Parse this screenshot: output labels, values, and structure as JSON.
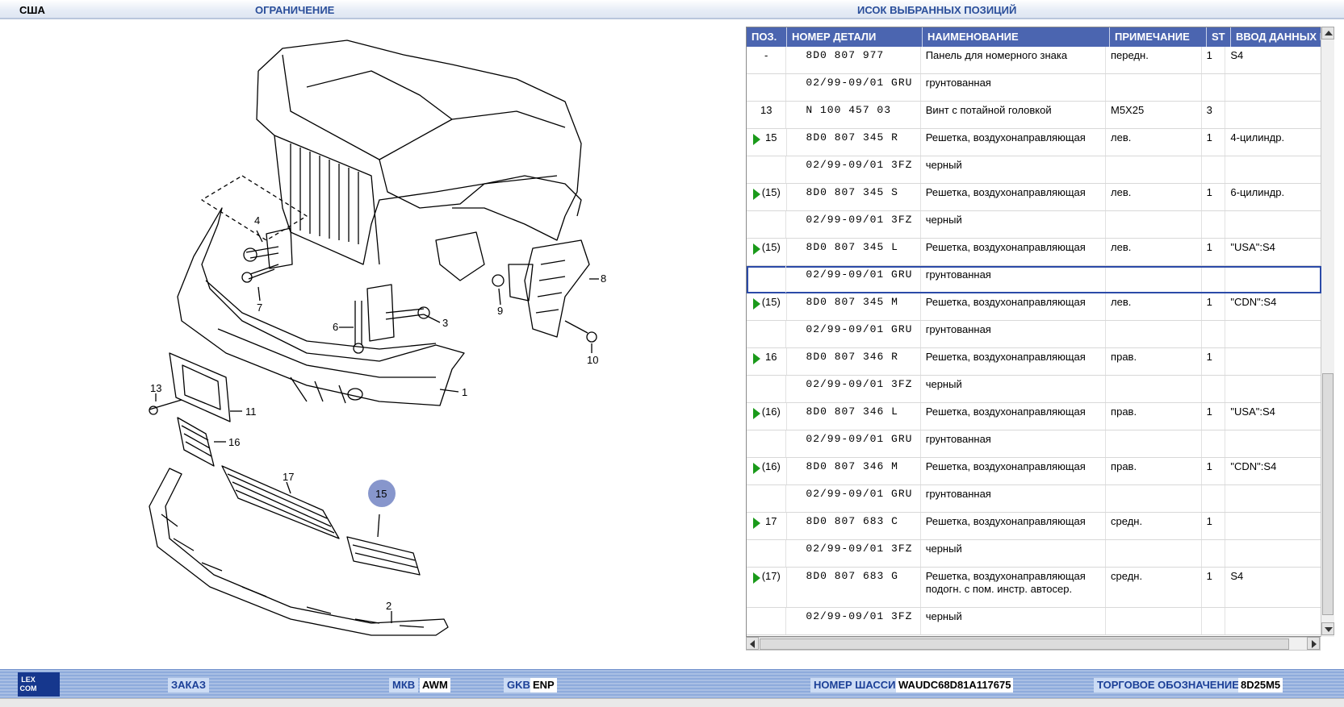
{
  "header": {
    "country": "США",
    "restriction_label": "ОГРАНИЧЕНИЕ",
    "selected_list_label": "ИСОК ВЫБРАННЫХ ПОЗИЦИЙ"
  },
  "diagram": {
    "callouts": [
      "4",
      "7",
      "6",
      "3",
      "8",
      "9",
      "10",
      "1",
      "13",
      "11",
      "16",
      "17",
      "15",
      "2"
    ],
    "highlighted_callout": "15",
    "highlight_color": "#8796cc"
  },
  "table": {
    "columns": [
      "ПОЗ.",
      "НОМЕР ДЕТАЛИ",
      "НАИМЕНОВАНИЕ",
      "ПРИМЕЧАНИЕ",
      "ST",
      "ВВОД ДАННЫХ ПО"
    ],
    "header_color": "#4b65b0",
    "rows": [
      {
        "pos": "-",
        "part": "8D0 807 977",
        "name": "Панель для номерного знака",
        "note": "передн.",
        "st": "1",
        "data": "S4",
        "arrow": false
      },
      {
        "pos": "",
        "part": "02/99-09/01 GRU",
        "name": "грунтованная",
        "note": "",
        "st": "",
        "data": "",
        "arrow": false
      },
      {
        "pos": "13",
        "part": "N   100 457 03",
        "name": "Винт с потайной головкой",
        "note": "M5X25",
        "st": "3",
        "data": "",
        "arrow": false
      },
      {
        "pos": "15",
        "part": "8D0 807 345 R",
        "name": "Решетка, воздухонаправляющая",
        "note": "лев.",
        "st": "1",
        "data": "4-цилиндр.",
        "arrow": true
      },
      {
        "pos": "",
        "part": "02/99-09/01 3FZ",
        "name": "черный",
        "note": "",
        "st": "",
        "data": "",
        "arrow": false
      },
      {
        "pos": "(15)",
        "part": "8D0 807 345 S",
        "name": "Решетка, воздухонаправляющая",
        "note": "лев.",
        "st": "1",
        "data": "6-цилиндр.",
        "arrow": true
      },
      {
        "pos": "",
        "part": "02/99-09/01 3FZ",
        "name": "черный",
        "note": "",
        "st": "",
        "data": "",
        "arrow": false
      },
      {
        "pos": "(15)",
        "part": "8D0 807 345 L",
        "name": "Решетка, воздухонаправляющая",
        "note": "лев.",
        "st": "1",
        "data": "\"USA\":S4",
        "arrow": true
      },
      {
        "pos": "",
        "part": "02/99-09/01 GRU",
        "name": "грунтованная",
        "note": "",
        "st": "",
        "data": "",
        "arrow": false,
        "selected": true
      },
      {
        "pos": "(15)",
        "part": "8D0 807 345 M",
        "name": "Решетка, воздухонаправляющая",
        "note": "лев.",
        "st": "1",
        "data": "\"CDN\":S4",
        "arrow": true
      },
      {
        "pos": "",
        "part": "02/99-09/01 GRU",
        "name": "грунтованная",
        "note": "",
        "st": "",
        "data": "",
        "arrow": false
      },
      {
        "pos": "16",
        "part": "8D0 807 346 R",
        "name": "Решетка, воздухонаправляющая",
        "note": "прав.",
        "st": "1",
        "data": "",
        "arrow": true
      },
      {
        "pos": "",
        "part": "02/99-09/01 3FZ",
        "name": "черный",
        "note": "",
        "st": "",
        "data": "",
        "arrow": false
      },
      {
        "pos": "(16)",
        "part": "8D0 807 346 L",
        "name": "Решетка, воздухонаправляющая",
        "note": "прав.",
        "st": "1",
        "data": "\"USA\":S4",
        "arrow": true
      },
      {
        "pos": "",
        "part": "02/99-09/01 GRU",
        "name": "грунтованная",
        "note": "",
        "st": "",
        "data": "",
        "arrow": false
      },
      {
        "pos": "(16)",
        "part": "8D0 807 346 M",
        "name": "Решетка, воздухонаправляющая",
        "note": "прав.",
        "st": "1",
        "data": "\"CDN\":S4",
        "arrow": true
      },
      {
        "pos": "",
        "part": "02/99-09/01 GRU",
        "name": "грунтованная",
        "note": "",
        "st": "",
        "data": "",
        "arrow": false
      },
      {
        "pos": "17",
        "part": "8D0 807 683 C",
        "name": "Решетка, воздухонаправляющая",
        "note": "средн.",
        "st": "1",
        "data": "",
        "arrow": true
      },
      {
        "pos": "",
        "part": "02/99-09/01 3FZ",
        "name": "черный",
        "note": "",
        "st": "",
        "data": "",
        "arrow": false
      },
      {
        "pos": "(17)",
        "part": "8D0 807 683 G",
        "name": "Решетка, воздухонаправляющая",
        "name2": "подогн. с пом. инстр. автосер.",
        "note": "средн.",
        "st": "1",
        "data": "S4",
        "arrow": true,
        "tall": true
      },
      {
        "pos": "",
        "part": "02/99-09/01 3FZ",
        "name": "черный",
        "note": "",
        "st": "",
        "data": "",
        "arrow": false
      }
    ]
  },
  "statusbar": {
    "logo_text": "LEX COM",
    "order_label": "ЗАКАЗ",
    "mkb_label": "МКВ",
    "mkb_value": "AWM",
    "gkb_label": "GKB",
    "gkb_value": "ENP",
    "chassis_label": "НОМЕР ШАССИ",
    "chassis_value": "WAUDC68D81A117675",
    "trade_label": "ТОРГОВОЕ ОБОЗНАЧЕНИЕ",
    "trade_value": "8D25M5"
  }
}
